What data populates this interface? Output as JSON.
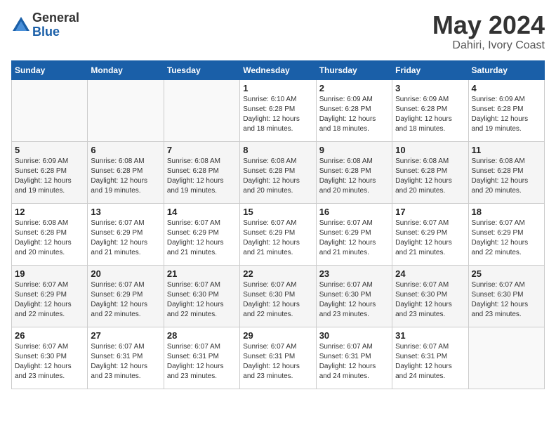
{
  "logo": {
    "general": "General",
    "blue": "Blue"
  },
  "title": "May 2024",
  "location": "Dahiri, Ivory Coast",
  "days_header": [
    "Sunday",
    "Monday",
    "Tuesday",
    "Wednesday",
    "Thursday",
    "Friday",
    "Saturday"
  ],
  "weeks": [
    [
      {
        "day": "",
        "info": ""
      },
      {
        "day": "",
        "info": ""
      },
      {
        "day": "",
        "info": ""
      },
      {
        "day": "1",
        "info": "Sunrise: 6:10 AM\nSunset: 6:28 PM\nDaylight: 12 hours\nand 18 minutes."
      },
      {
        "day": "2",
        "info": "Sunrise: 6:09 AM\nSunset: 6:28 PM\nDaylight: 12 hours\nand 18 minutes."
      },
      {
        "day": "3",
        "info": "Sunrise: 6:09 AM\nSunset: 6:28 PM\nDaylight: 12 hours\nand 18 minutes."
      },
      {
        "day": "4",
        "info": "Sunrise: 6:09 AM\nSunset: 6:28 PM\nDaylight: 12 hours\nand 19 minutes."
      }
    ],
    [
      {
        "day": "5",
        "info": "Sunrise: 6:09 AM\nSunset: 6:28 PM\nDaylight: 12 hours\nand 19 minutes."
      },
      {
        "day": "6",
        "info": "Sunrise: 6:08 AM\nSunset: 6:28 PM\nDaylight: 12 hours\nand 19 minutes."
      },
      {
        "day": "7",
        "info": "Sunrise: 6:08 AM\nSunset: 6:28 PM\nDaylight: 12 hours\nand 19 minutes."
      },
      {
        "day": "8",
        "info": "Sunrise: 6:08 AM\nSunset: 6:28 PM\nDaylight: 12 hours\nand 20 minutes."
      },
      {
        "day": "9",
        "info": "Sunrise: 6:08 AM\nSunset: 6:28 PM\nDaylight: 12 hours\nand 20 minutes."
      },
      {
        "day": "10",
        "info": "Sunrise: 6:08 AM\nSunset: 6:28 PM\nDaylight: 12 hours\nand 20 minutes."
      },
      {
        "day": "11",
        "info": "Sunrise: 6:08 AM\nSunset: 6:28 PM\nDaylight: 12 hours\nand 20 minutes."
      }
    ],
    [
      {
        "day": "12",
        "info": "Sunrise: 6:08 AM\nSunset: 6:28 PM\nDaylight: 12 hours\nand 20 minutes."
      },
      {
        "day": "13",
        "info": "Sunrise: 6:07 AM\nSunset: 6:29 PM\nDaylight: 12 hours\nand 21 minutes."
      },
      {
        "day": "14",
        "info": "Sunrise: 6:07 AM\nSunset: 6:29 PM\nDaylight: 12 hours\nand 21 minutes."
      },
      {
        "day": "15",
        "info": "Sunrise: 6:07 AM\nSunset: 6:29 PM\nDaylight: 12 hours\nand 21 minutes."
      },
      {
        "day": "16",
        "info": "Sunrise: 6:07 AM\nSunset: 6:29 PM\nDaylight: 12 hours\nand 21 minutes."
      },
      {
        "day": "17",
        "info": "Sunrise: 6:07 AM\nSunset: 6:29 PM\nDaylight: 12 hours\nand 21 minutes."
      },
      {
        "day": "18",
        "info": "Sunrise: 6:07 AM\nSunset: 6:29 PM\nDaylight: 12 hours\nand 22 minutes."
      }
    ],
    [
      {
        "day": "19",
        "info": "Sunrise: 6:07 AM\nSunset: 6:29 PM\nDaylight: 12 hours\nand 22 minutes."
      },
      {
        "day": "20",
        "info": "Sunrise: 6:07 AM\nSunset: 6:29 PM\nDaylight: 12 hours\nand 22 minutes."
      },
      {
        "day": "21",
        "info": "Sunrise: 6:07 AM\nSunset: 6:30 PM\nDaylight: 12 hours\nand 22 minutes."
      },
      {
        "day": "22",
        "info": "Sunrise: 6:07 AM\nSunset: 6:30 PM\nDaylight: 12 hours\nand 22 minutes."
      },
      {
        "day": "23",
        "info": "Sunrise: 6:07 AM\nSunset: 6:30 PM\nDaylight: 12 hours\nand 23 minutes."
      },
      {
        "day": "24",
        "info": "Sunrise: 6:07 AM\nSunset: 6:30 PM\nDaylight: 12 hours\nand 23 minutes."
      },
      {
        "day": "25",
        "info": "Sunrise: 6:07 AM\nSunset: 6:30 PM\nDaylight: 12 hours\nand 23 minutes."
      }
    ],
    [
      {
        "day": "26",
        "info": "Sunrise: 6:07 AM\nSunset: 6:30 PM\nDaylight: 12 hours\nand 23 minutes."
      },
      {
        "day": "27",
        "info": "Sunrise: 6:07 AM\nSunset: 6:31 PM\nDaylight: 12 hours\nand 23 minutes."
      },
      {
        "day": "28",
        "info": "Sunrise: 6:07 AM\nSunset: 6:31 PM\nDaylight: 12 hours\nand 23 minutes."
      },
      {
        "day": "29",
        "info": "Sunrise: 6:07 AM\nSunset: 6:31 PM\nDaylight: 12 hours\nand 23 minutes."
      },
      {
        "day": "30",
        "info": "Sunrise: 6:07 AM\nSunset: 6:31 PM\nDaylight: 12 hours\nand 24 minutes."
      },
      {
        "day": "31",
        "info": "Sunrise: 6:07 AM\nSunset: 6:31 PM\nDaylight: 12 hours\nand 24 minutes."
      },
      {
        "day": "",
        "info": ""
      }
    ]
  ]
}
